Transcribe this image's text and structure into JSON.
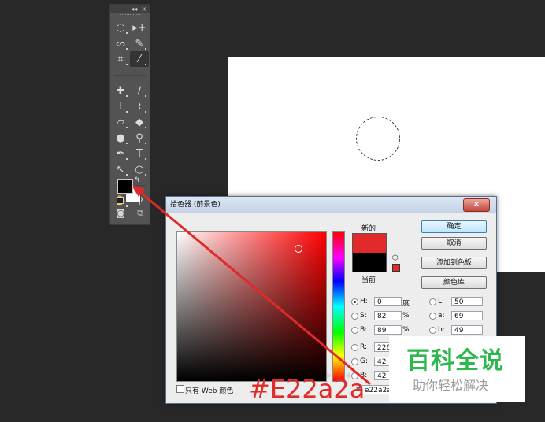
{
  "toolbox": {
    "collapse_glyph": "◂◂",
    "close_glyph": "×",
    "tools": [
      {
        "name": "elliptical-marquee-icon",
        "glyph": "◌"
      },
      {
        "name": "move-icon",
        "glyph": "▸+"
      },
      {
        "name": "lasso-icon",
        "glyph": "ᔕ"
      },
      {
        "name": "quick-selection-icon",
        "glyph": "✎"
      },
      {
        "name": "crop-icon",
        "glyph": "⌗"
      },
      {
        "name": "eyedropper-icon",
        "glyph": "⁄"
      },
      {
        "name": "healing-brush-icon",
        "glyph": "✚"
      },
      {
        "name": "brush-icon",
        "glyph": "∕"
      },
      {
        "name": "clone-stamp-icon",
        "glyph": "⊥"
      },
      {
        "name": "history-brush-icon",
        "glyph": "⌇"
      },
      {
        "name": "eraser-icon",
        "glyph": "▱"
      },
      {
        "name": "paint-bucket-icon",
        "glyph": "◆"
      },
      {
        "name": "blur-icon",
        "glyph": "●"
      },
      {
        "name": "dodge-icon",
        "glyph": "⚲"
      },
      {
        "name": "pen-icon",
        "glyph": "✒"
      },
      {
        "name": "type-icon",
        "glyph": "T"
      },
      {
        "name": "path-selection-icon",
        "glyph": "↖"
      },
      {
        "name": "ellipse-shape-icon",
        "glyph": "○"
      },
      {
        "name": "hand-icon",
        "glyph": "✋"
      },
      {
        "name": "zoom-icon",
        "glyph": "⚲"
      }
    ],
    "swap_glyph": "↰",
    "quick_mask_glyph": "◙",
    "screen_mode_glyph": "⧉"
  },
  "dialog": {
    "title": "拾色器 (前景色)",
    "close_label": "x",
    "new_label": "新的",
    "current_label": "当前",
    "cube_glyph": "⬡",
    "buttons": {
      "ok": "确定",
      "cancel": "取消",
      "add_to_swatches": "添加到色板",
      "color_libraries": "颜色库"
    },
    "hsb": [
      {
        "label": "H:",
        "value": "0",
        "unit": "度",
        "selected": true
      },
      {
        "label": "S:",
        "value": "82",
        "unit": "%",
        "selected": false
      },
      {
        "label": "B:",
        "value": "89",
        "unit": "%",
        "selected": false
      }
    ],
    "rgb": [
      {
        "label": "R:",
        "value": "226"
      },
      {
        "label": "G:",
        "value": "42"
      },
      {
        "label": "B:",
        "value": "42"
      }
    ],
    "lab": [
      {
        "label": "L:",
        "value": "50"
      },
      {
        "label": "a:",
        "value": "69"
      },
      {
        "label": "b:",
        "value": "49"
      }
    ],
    "hex_prefix": "#",
    "hex_value": "e22a2a",
    "web_only_label": "只有 Web 颜色"
  },
  "annotation": {
    "text": "#E22a2a",
    "color": "#e22a2a"
  },
  "watermark": {
    "title": "百科全说",
    "subtitle": "助你轻松解决"
  },
  "colors": {
    "new_color": "#e22a2a",
    "current_color": "#000000",
    "workspace_bg": "#282828",
    "watermark_green": "#2db84d"
  }
}
